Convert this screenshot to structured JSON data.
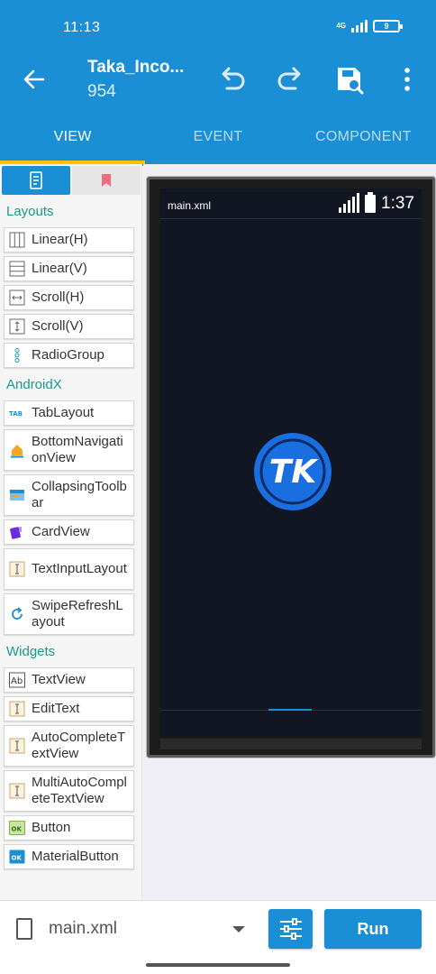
{
  "status_bar": {
    "time": "11:13",
    "network": "4G",
    "battery": "9"
  },
  "toolbar": {
    "title": "Taka_Inco...",
    "subtitle": "954"
  },
  "tabs": [
    {
      "label": "VIEW",
      "active": true
    },
    {
      "label": "EVENT",
      "active": false
    },
    {
      "label": "COMPONENT",
      "active": false
    }
  ],
  "palette": {
    "sections": [
      {
        "title": "Layouts"
      },
      {
        "title": "AndroidX"
      },
      {
        "title": "Widgets"
      }
    ],
    "layouts": [
      "Linear(H)",
      "Linear(V)",
      "Scroll(H)",
      "Scroll(V)",
      "RadioGroup"
    ],
    "androidx": [
      "TabLayout",
      "BottomNavigationView",
      "CollapsingToolbar",
      "CardView",
      "TextInputLayout",
      "SwipeRefreshLayout"
    ],
    "widgets": [
      "TextView",
      "EditText",
      "AutoCompleteTextView",
      "MultiAutoCompleteTextView",
      "Button",
      "MaterialButton"
    ]
  },
  "preview": {
    "file": "main.xml",
    "clock": "1:37",
    "logo_text": "TK"
  },
  "bottom": {
    "file_name": "main.xml",
    "run_label": "Run"
  },
  "colors": {
    "primary": "#1a8fd6",
    "accent": "#ffc107",
    "section": "#1a9a8c",
    "preview_bg": "#111622"
  }
}
